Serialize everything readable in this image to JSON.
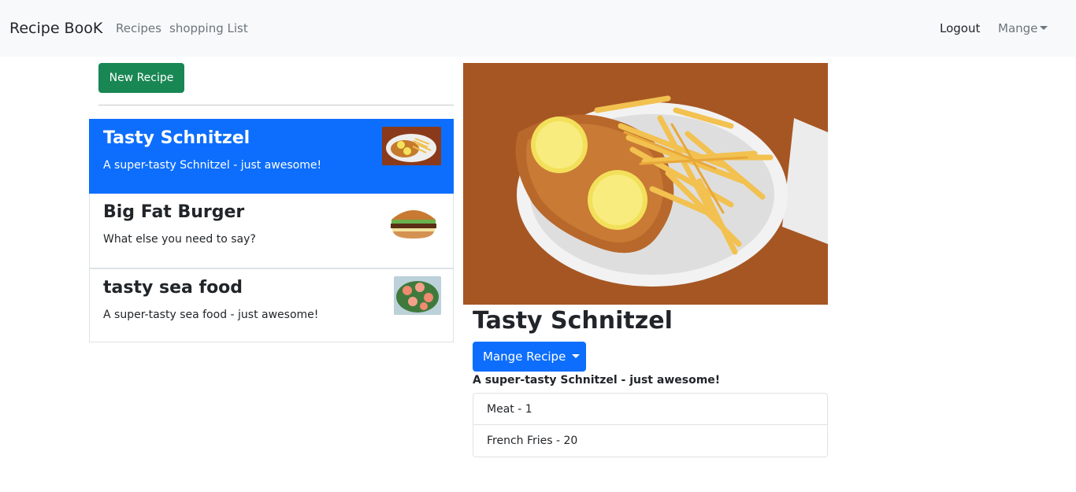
{
  "navbar": {
    "brand": "Recipe BooK",
    "links": [
      "Recipes",
      "shopping List"
    ],
    "logout": "Logout",
    "manage": "Mange"
  },
  "sidebar": {
    "new_recipe_label": "New Recipe",
    "recipes": [
      {
        "name": "Tasty Schnitzel",
        "description": "A super-tasty Schnitzel - just awesome!",
        "active": true
      },
      {
        "name": "Big Fat Burger",
        "description": "What else you need to say?",
        "active": false
      },
      {
        "name": "tasty sea food",
        "description": "A super-tasty sea food - just awesome!",
        "active": false
      }
    ]
  },
  "detail": {
    "title": "Tasty Schnitzel",
    "manage_label": "Mange Recipe",
    "description": "A super-tasty Schnitzel - just awesome!",
    "ingredients": [
      "Meat - 1",
      "French Fries - 20"
    ]
  },
  "colors": {
    "accent": "#0d6efd",
    "success": "#198754",
    "navbar_bg": "#f8f9fa"
  }
}
